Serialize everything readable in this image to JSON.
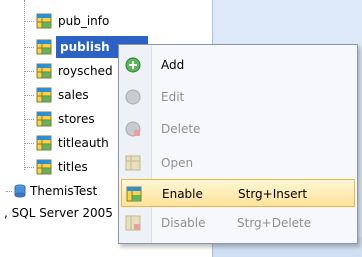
{
  "tree": {
    "tables": [
      {
        "label": "pub_info"
      },
      {
        "label": "publish"
      },
      {
        "label": "roysched"
      },
      {
        "label": "sales"
      },
      {
        "label": "stores"
      },
      {
        "label": "titleauth"
      },
      {
        "label": "titles"
      }
    ],
    "database_label": "ThemisTest",
    "server_label": ", SQL Server 2005"
  },
  "context_menu": {
    "items": [
      {
        "label": "Add",
        "shortcut": "",
        "enabled": true
      },
      {
        "label": "Edit",
        "shortcut": "",
        "enabled": false
      },
      {
        "label": "Delete",
        "shortcut": "",
        "enabled": false
      },
      {
        "label": "Open",
        "shortcut": "",
        "enabled": false
      },
      {
        "label": "Enable",
        "shortcut": "Strg+Insert",
        "enabled": true,
        "highlighted": true
      },
      {
        "label": "Disable",
        "shortcut": "Strg+Delete",
        "enabled": false
      }
    ]
  },
  "colors": {
    "selection": "#2b62c3",
    "highlight": "#ffe29a",
    "right_pane": "#dde9f8"
  }
}
